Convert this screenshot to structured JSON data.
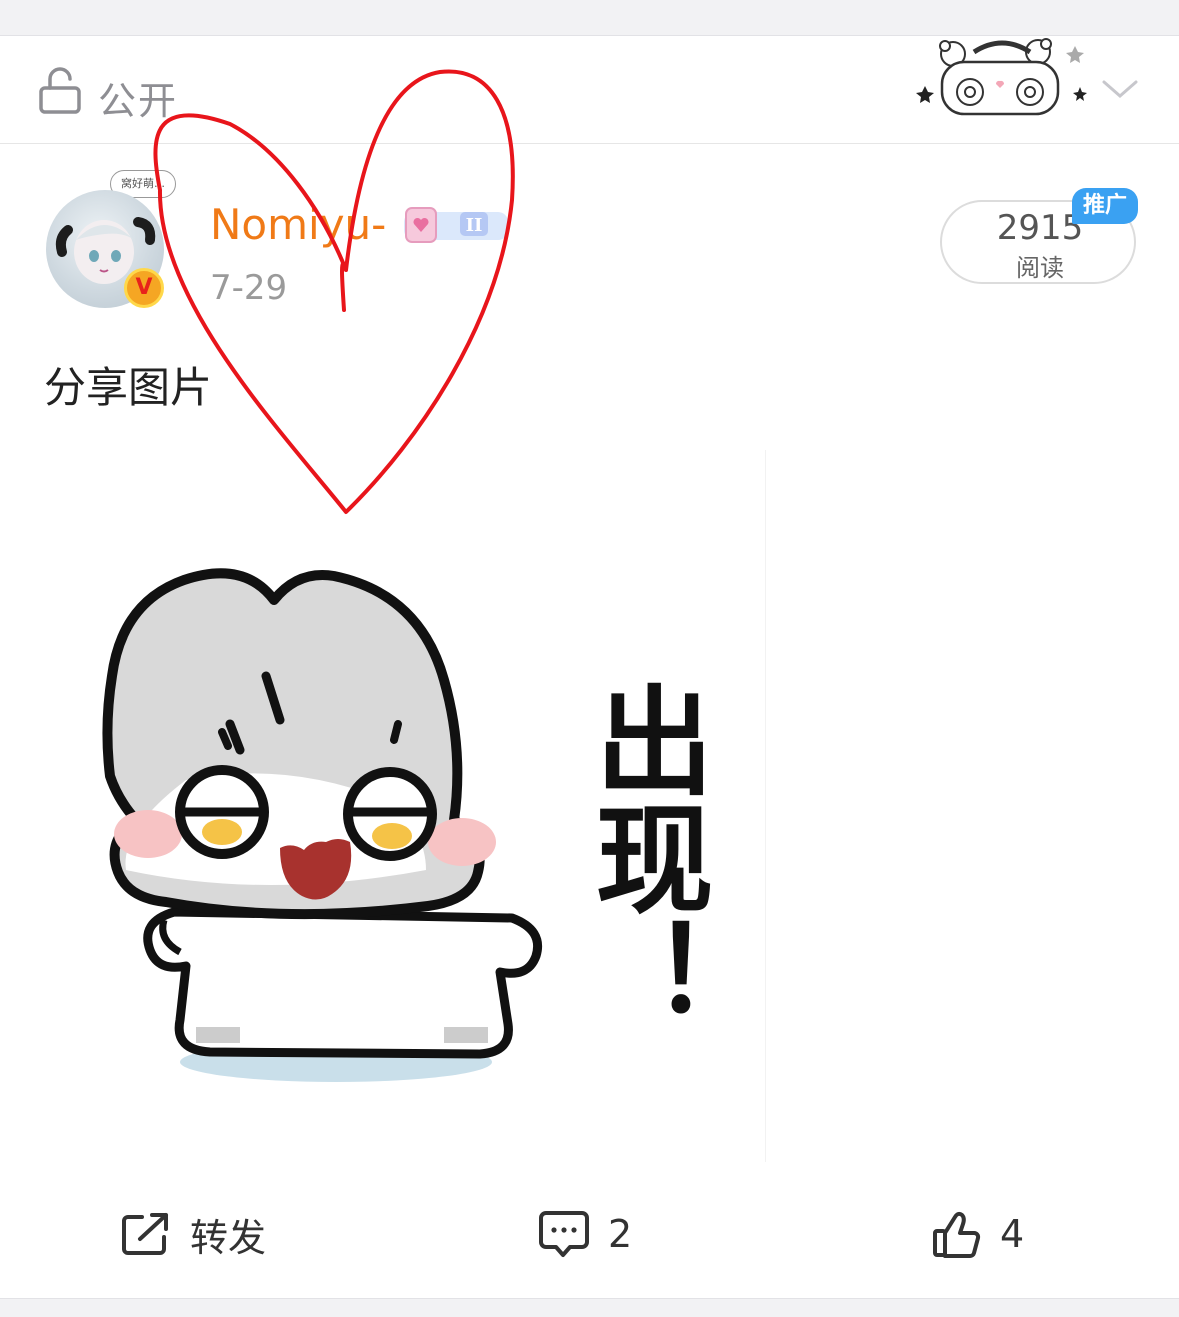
{
  "visibility": {
    "label": "公开",
    "icon": "unlock-icon"
  },
  "post": {
    "author": "Nomiyu-",
    "date": "7-29",
    "verified_badge": "V",
    "avatar_bubble": "窝好萌…",
    "reads": {
      "count": "2915",
      "label": "阅读"
    },
    "promo_tag": "推广",
    "text": "分享图片"
  },
  "image": {
    "caption": "出现！"
  },
  "actions": {
    "repost": {
      "label": "转发",
      "icon": "share-icon"
    },
    "comment": {
      "count": "2",
      "icon": "comment-icon"
    },
    "like": {
      "count": "4",
      "icon": "thumbs-up-icon"
    }
  },
  "colors": {
    "username": "#f07a17",
    "promo": "#3aa1f2",
    "heart_annotation": "#e8151b"
  }
}
